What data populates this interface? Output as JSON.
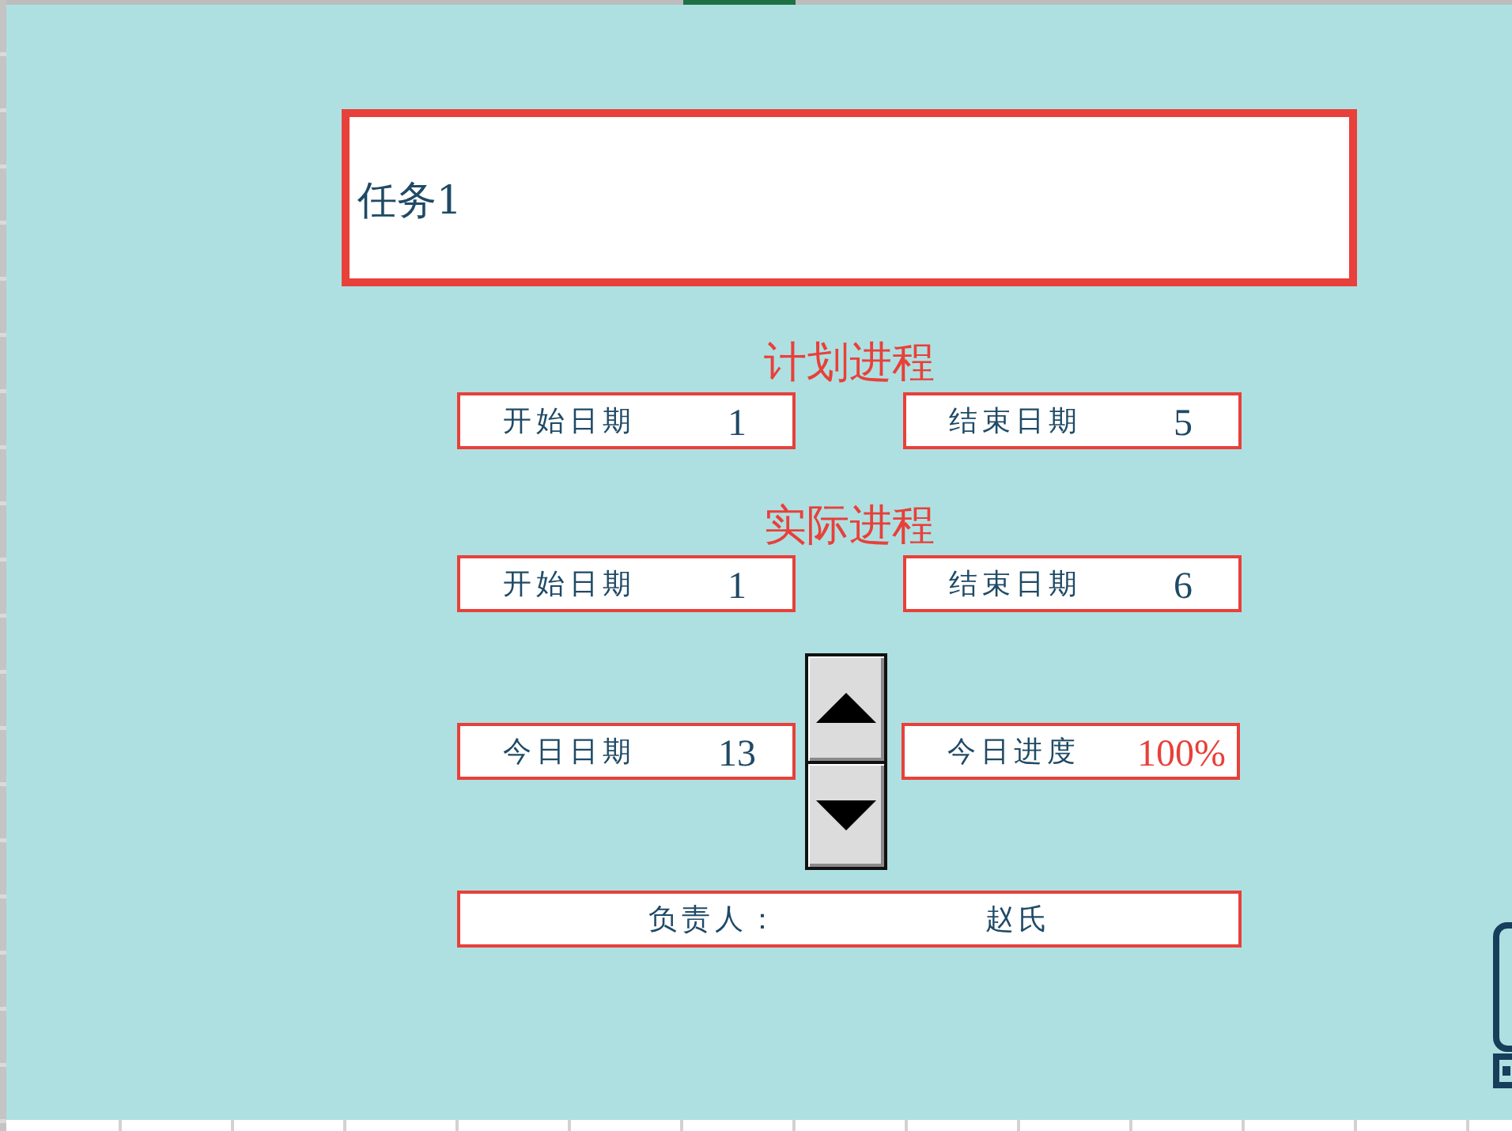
{
  "sheet": {
    "columns": [
      {
        "selected": false
      },
      {
        "selected": false
      },
      {
        "selected": false
      },
      {
        "selected": false
      },
      {
        "selected": false
      },
      {
        "selected": false
      },
      {
        "selected": true
      },
      {
        "selected": false
      },
      {
        "selected": false
      },
      {
        "selected": false
      },
      {
        "selected": false
      },
      {
        "selected": false
      },
      {
        "selected": false
      },
      {
        "selected": false
      }
    ]
  },
  "task": {
    "title": "任务1"
  },
  "sections": [
    {
      "heading": "计划进程",
      "fields": [
        {
          "label": "开始日期",
          "value": "1"
        },
        {
          "label": "结束日期",
          "value": "5"
        }
      ]
    },
    {
      "heading": "实际进程",
      "fields": [
        {
          "label": "开始日期",
          "value": "1"
        },
        {
          "label": "结束日期",
          "value": "6"
        }
      ]
    }
  ],
  "today": {
    "fields": [
      {
        "label": "今日日期",
        "value": "13",
        "color": "#1f4a66"
      },
      {
        "label": "今日进度",
        "value": "100%",
        "color": "#e8403a"
      }
    ]
  },
  "owner": {
    "label": "负责人：",
    "value": "赵氏"
  }
}
